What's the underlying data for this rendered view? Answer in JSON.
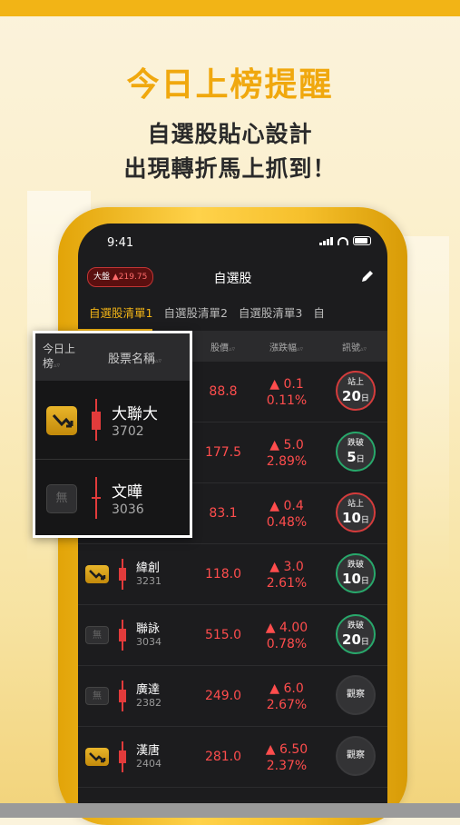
{
  "headline": "今日上榜提醒",
  "subheadline_1": "自選股貼心設計",
  "subheadline_2": "出現轉折馬上抓到！",
  "status_bar": {
    "time": "9:41"
  },
  "nav": {
    "index_label": "大盤",
    "index_change": "▲219.75",
    "title": "自選股"
  },
  "tabs": [
    "自選股清單1",
    "自選股清單2",
    "自選股清單3",
    "自"
  ],
  "columns": {
    "price": "股價",
    "change": "漲跌幅",
    "signal": "訊號",
    "sort_glyph": "▵▿"
  },
  "rows": [
    {
      "flag": "gold",
      "name": "大聯大",
      "code": "3702",
      "price": "88.8",
      "change": "▲ 0.1",
      "pct": "0.11%",
      "signal_type": "up",
      "signal_l1": "站上",
      "signal_num": "20",
      "signal_unit": "日"
    },
    {
      "flag": "none",
      "name": "文曄",
      "code": "3036",
      "price": "177.5",
      "change": "▲ 5.0",
      "pct": "2.89%",
      "signal_type": "dn",
      "signal_l1": "跌破",
      "signal_num": "5",
      "signal_unit": "日"
    },
    {
      "flag": "none",
      "name": "",
      "code": "",
      "price": "83.1",
      "change": "▲ 0.4",
      "pct": "0.48%",
      "signal_type": "up",
      "signal_l1": "站上",
      "signal_num": "10",
      "signal_unit": "日"
    },
    {
      "flag": "gold",
      "name": "緯創",
      "code": "3231",
      "price": "118.0",
      "change": "▲ 3.0",
      "pct": "2.61%",
      "signal_type": "dn",
      "signal_l1": "跌破",
      "signal_num": "10",
      "signal_unit": "日"
    },
    {
      "flag": "none",
      "name": "聯詠",
      "code": "3034",
      "price": "515.0",
      "change": "▲ 4.00",
      "pct": "0.78%",
      "signal_type": "dn",
      "signal_l1": "跌破",
      "signal_num": "20",
      "signal_unit": "日"
    },
    {
      "flag": "none",
      "name": "廣達",
      "code": "2382",
      "price": "249.0",
      "change": "▲ 6.0",
      "pct": "2.67%",
      "signal_type": "watch",
      "signal_l1": "觀察",
      "signal_num": "",
      "signal_unit": ""
    },
    {
      "flag": "gold",
      "name": "漢唐",
      "code": "2404",
      "price": "281.0",
      "change": "▲ 6.50",
      "pct": "2.37%",
      "signal_type": "watch",
      "signal_l1": "觀察",
      "signal_num": "",
      "signal_unit": ""
    }
  ],
  "popup": {
    "col1": "今日上榜",
    "col2": "股票名稱",
    "none_label": "無",
    "items": [
      {
        "flag": "gold",
        "name": "大聯大",
        "code": "3702"
      },
      {
        "flag": "none",
        "name": "文曄",
        "code": "3036"
      }
    ]
  },
  "colors": {
    "accent": "#f2b416",
    "up": "#ff4d4d",
    "down": "#28a86b",
    "bg": "#1c1c1e"
  }
}
